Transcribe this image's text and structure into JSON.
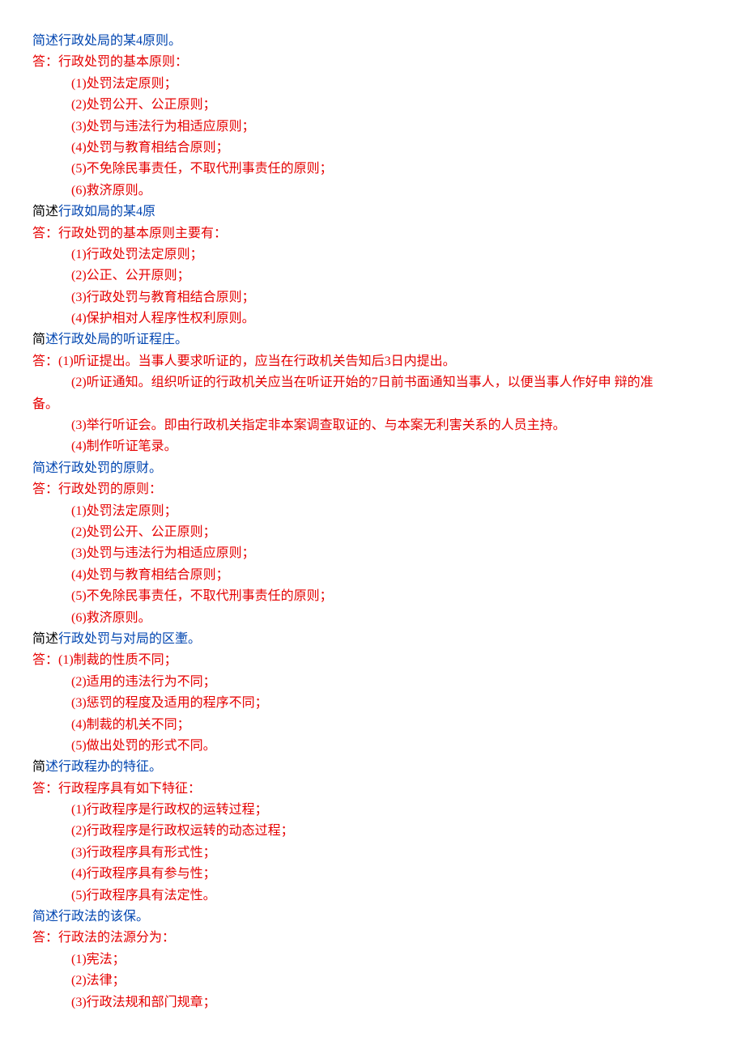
{
  "sections": [
    {
      "question": {
        "type": "blue",
        "text": "简述行政处局的某4原则。"
      },
      "answer_lead": "答：行政处罚的基本原则：",
      "items": [
        {
          "num": "(1)",
          "text": "处罚法定原则；"
        },
        {
          "num": "(2)",
          "text": "处罚公开、公正原则；"
        },
        {
          "num": "(3)",
          "text": "处罚与违法行为相适应原则；"
        },
        {
          "num": "(4)",
          "text": "处罚与教育相结合原则；"
        },
        {
          "num": "(5)",
          "text": "不免除民事责任，不取代刑事责任的原则；"
        },
        {
          "num": "(6)",
          "text": "救济原则。"
        }
      ]
    },
    {
      "question": {
        "type": "mixed",
        "black": "简述",
        "blue": "行政如局的某4原"
      },
      "answer_lead": "答：行政处罚的基本原则主要有：",
      "items": [
        {
          "num": "(1)",
          "text": "行政处罚法定原则；"
        },
        {
          "num": "(2)",
          "text": "公正、公开原则；"
        },
        {
          "num": "(3)",
          "text": "行政处罚与教育相结合原则；"
        },
        {
          "num": "(4)",
          "text": "保护相对人程序性权利原则。"
        }
      ]
    },
    {
      "question": {
        "type": "mixed",
        "black": "简",
        "blue": "述行政处局的听证程庄。"
      },
      "answer_inline": {
        "prefix": "答：",
        "num": "(1)",
        "text": "听证提出。当事人要求听证的，应当在行政机关告知后3日内提出。"
      },
      "items": [
        {
          "num": "(2)",
          "text": "听证通知。组织听证的行政机关应当在听证开始的7日前书面通知当事人，以便当事人作好申  辩的准备。",
          "wrap": true
        },
        {
          "num": "(3)",
          "text": "举行听证会。即由行政机关指定非本案调查取证的、与本案无利害关系的人员主持。"
        },
        {
          "num": "(4)",
          "text": "制作听证笔录。"
        }
      ]
    },
    {
      "question": {
        "type": "blue",
        "text": "简述行政处罚的原财。"
      },
      "answer_lead": "答：行政处罚的原则：",
      "items": [
        {
          "num": "(1)",
          "text": "处罚法定原则；"
        },
        {
          "num": "(2)",
          "text": "处罚公开、公正原则；"
        },
        {
          "num": "(3)",
          "text": "处罚与违法行为相适应原则；"
        },
        {
          "num": "(4)",
          "text": "处罚与教育相结合原则；"
        },
        {
          "num": "(5)",
          "text": "不免除民事责任，不取代刑事责任的原则；"
        },
        {
          "num": "(6)",
          "text": "救济原则。"
        }
      ]
    },
    {
      "question": {
        "type": "mixed",
        "black": "简述",
        "blue": "行政处罚与对局的区壍。"
      },
      "answer_inline": {
        "prefix": "答：",
        "num": "(1)",
        "text": "制裁的性质不同；"
      },
      "items": [
        {
          "num": "(2)",
          "text": "适用的违法行为不同；"
        },
        {
          "num": "(3)",
          "text": "惩罚的程度及适用的程序不同；"
        },
        {
          "num": "(4)",
          "text": "制裁的机关不同；"
        },
        {
          "num": "(5)",
          "text": "做出处罚的形式不同。"
        }
      ]
    },
    {
      "question": {
        "type": "mixed",
        "black": "简",
        "blue": "述行政程办的特征。"
      },
      "answer_lead": "答：行政程序具有如下特征：",
      "items": [
        {
          "num": "(1)",
          "text": "行政程序是行政权的运转过程；"
        },
        {
          "num": "(2)",
          "text": "行政程序是行政权运转的动态过程；"
        },
        {
          "num": "(3)",
          "text": "行政程序具有形式性；"
        },
        {
          "num": "(4)",
          "text": "行政程序具有参与性；"
        },
        {
          "num": "(5)",
          "text": "行政程序具有法定性。"
        }
      ]
    },
    {
      "question": {
        "type": "blue",
        "text": "简述行政法的该保。"
      },
      "answer_lead": "答：行政法的法源分为：",
      "items": [
        {
          "num": "(1)",
          "text": "宪法；"
        },
        {
          "num": "(2)",
          "text": "法律；"
        },
        {
          "num": "(3)",
          "text": "行政法规和部门规章；"
        }
      ]
    }
  ]
}
